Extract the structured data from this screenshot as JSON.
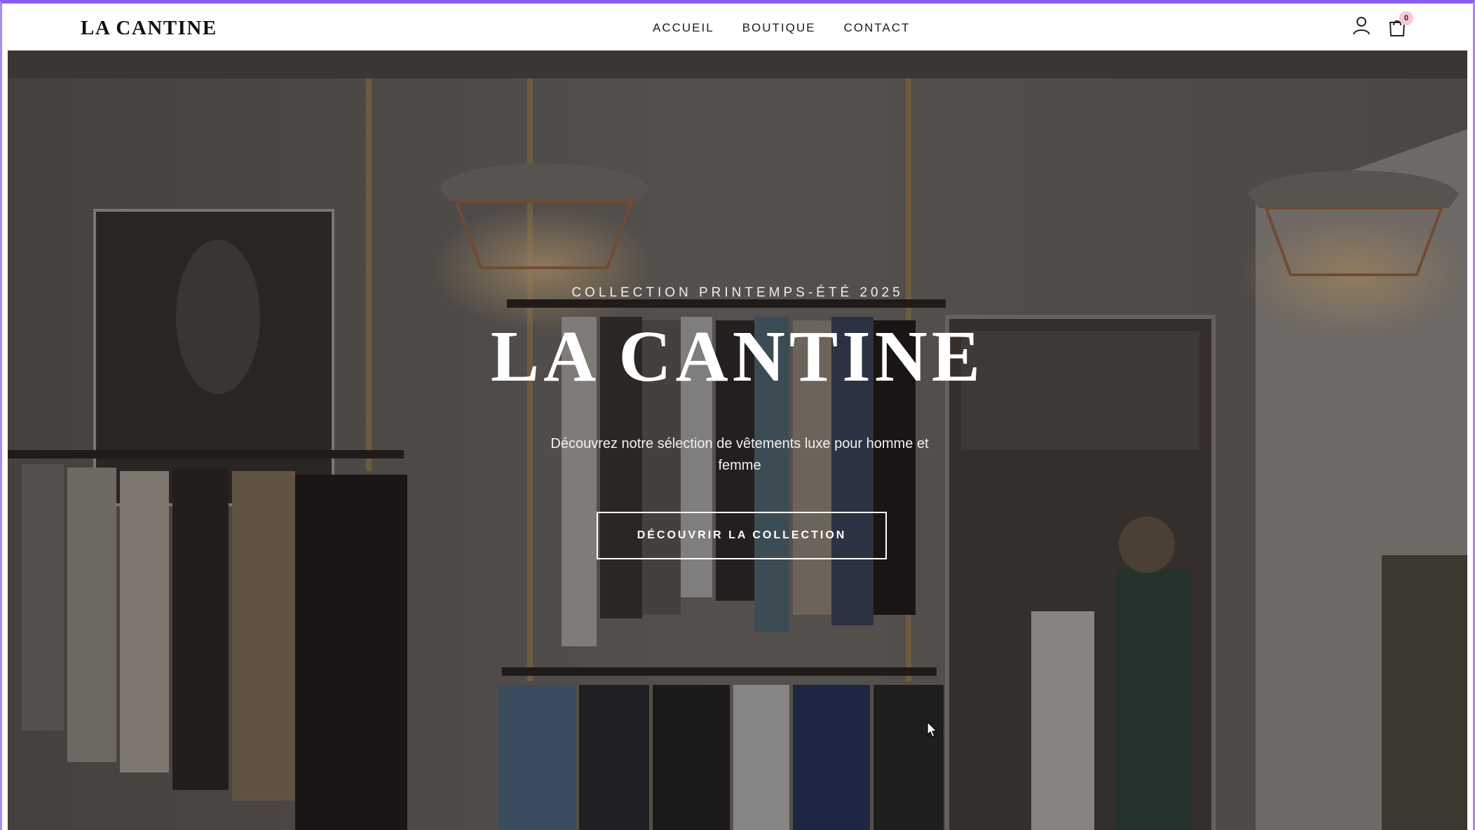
{
  "header": {
    "logo": "LA CANTINE",
    "nav": [
      {
        "label": "ACCUEIL"
      },
      {
        "label": "BOUTIQUE"
      },
      {
        "label": "CONTACT"
      }
    ],
    "account_icon": "user-icon",
    "cart_icon": "shopping-bag-icon",
    "cart_count": "0"
  },
  "hero": {
    "eyebrow": "COLLECTION PRINTEMPS-ÉTÉ 2025",
    "title": "LA CANTINE",
    "subtitle": "Découvrez notre sélection de vêtements luxe pour homme et femme",
    "cta_label": "DÉCOUVRIR LA COLLECTION"
  },
  "colors": {
    "accent_frame": "#8b5cf6",
    "cart_badge": "#f9c8d6",
    "header_bg": "#ffffff",
    "text_dark": "#111111"
  }
}
